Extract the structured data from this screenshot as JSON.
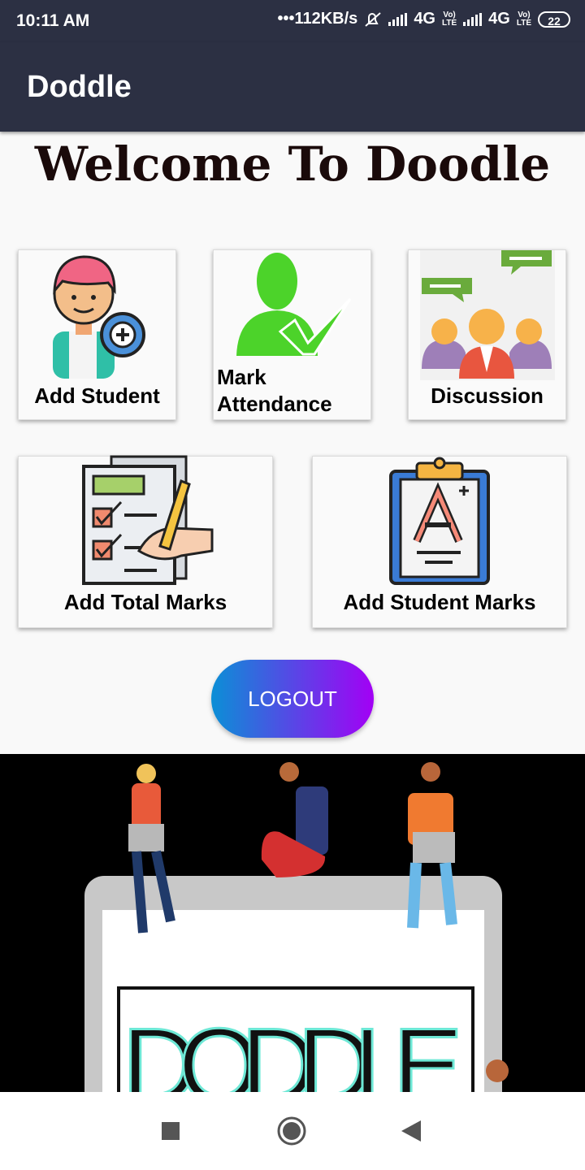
{
  "status_bar": {
    "time": "10:11 AM",
    "speed": "•••112KB/s",
    "net1": "4G",
    "net2": "4G",
    "battery": "22"
  },
  "app_bar": {
    "title": "Doddle"
  },
  "welcome": "Welcome To Doodle",
  "cards": {
    "add_student": "Add Student",
    "mark_attendance_line1": "Mark",
    "mark_attendance_line2": "Attendance",
    "discussion": "Discussion",
    "add_total_marks": "Add Total Marks",
    "add_student_marks": "Add Student Marks"
  },
  "logout_label": "LOGOUT",
  "banner_text": "DODDLE",
  "icons": [
    "add-student-icon",
    "attendance-icon",
    "discussion-icon",
    "total-marks-icon",
    "student-marks-icon",
    "nav-recents-icon",
    "nav-home-icon",
    "nav-back-icon"
  ]
}
